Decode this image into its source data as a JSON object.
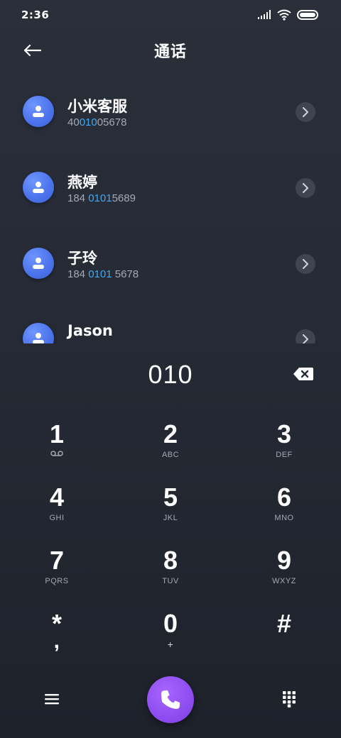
{
  "status_bar": {
    "time": "2:36",
    "icons": [
      "signal-icon",
      "wifi-icon",
      "battery-icon"
    ]
  },
  "header": {
    "title": "通话",
    "back_icon": "back-arrow-icon"
  },
  "contacts": [
    {
      "name": "小米客服",
      "number_before": "40",
      "number_match": "010",
      "number_after": "05678"
    },
    {
      "name": "燕婷",
      "number_before": "184 ",
      "number_match": "0101",
      "number_after": "5689"
    },
    {
      "name": "子玲",
      "number_before": "184 ",
      "number_match": "0101",
      "number_after": " 5678"
    },
    {
      "name": "Jason",
      "number_before": "",
      "number_match": "",
      "number_after": ""
    }
  ],
  "dialer": {
    "input": "010"
  },
  "keypad": [
    {
      "digit": "1",
      "letters": "",
      "icon": "voicemail-icon"
    },
    {
      "digit": "2",
      "letters": "ABC"
    },
    {
      "digit": "3",
      "letters": "DEF"
    },
    {
      "digit": "4",
      "letters": "GHI"
    },
    {
      "digit": "5",
      "letters": "JKL"
    },
    {
      "digit": "6",
      "letters": "MNO"
    },
    {
      "digit": "7",
      "letters": "PQRS"
    },
    {
      "digit": "8",
      "letters": "TUV"
    },
    {
      "digit": "9",
      "letters": "WXYZ"
    },
    {
      "digit": "*",
      "letters": ","
    },
    {
      "digit": "0",
      "letters": "+"
    },
    {
      "digit": "#",
      "letters": ""
    }
  ],
  "colors": {
    "accent_blue": "#3fa9f5",
    "avatar_blue": "#4a72ea",
    "call_purple": "#8e4df0",
    "background": "#252a34"
  }
}
